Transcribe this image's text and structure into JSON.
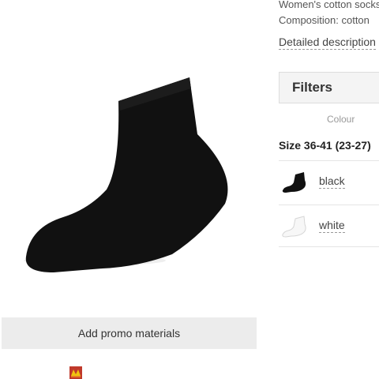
{
  "product": {
    "description_lines": [
      "Women's cotton socks",
      "Composition: cotton"
    ],
    "detail_link": "Detailed description",
    "image_icon": "black-ankle-sock-image"
  },
  "promo": {
    "button_label": "Add promo materials",
    "logo_icon": "promo-logo-icon"
  },
  "filters": {
    "title": "Filters",
    "column_header": "Colour",
    "size_label": "Size 36-41 (23-27)",
    "variants": [
      {
        "label": "black",
        "icon": "black-sock-thumb"
      },
      {
        "label": "white",
        "icon": "white-sock-thumb"
      }
    ]
  },
  "colors": {
    "sock": "#111111",
    "button_bg": "#ececec",
    "filters_bg": "#f4f4f4",
    "border": "#dddddd"
  }
}
